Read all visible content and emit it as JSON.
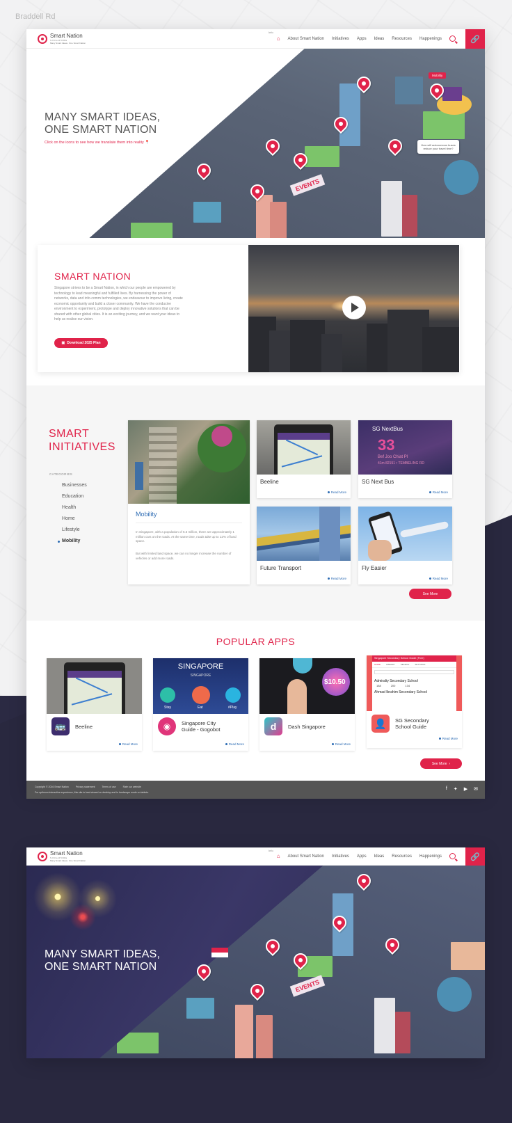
{
  "street_label": "Braddell Rd",
  "nav": {
    "logo_title": "Smart Nation",
    "logo_country": "S I N G A P O R E",
    "logo_tagline": "Many Smart Ideas • One Smart Nation",
    "lang": "Info",
    "items": [
      "About Smart Nation",
      "Initiatives",
      "Apps",
      "Ideas",
      "Resources",
      "Happenings"
    ],
    "link_icon": "link-icon"
  },
  "hero": {
    "title_line1": "MANY SMART IDEAS,",
    "title_line2": "ONE SMART NATION",
    "subtitle": "Click on the icons to see how we translate them into reality",
    "mobility_tag": "Mobility",
    "bubble_text": "How will autonomous buses reduce your travel time?",
    "events_sign": "EVENTS"
  },
  "smart_nation": {
    "title": "SMART NATION",
    "body": "Singapore strives to be a Smart Nation, in which our people are empowered by technology to lead meaningful and fulfilled lives. By harnessing the power of networks, data and info-comm technologies, we endeavour to improve living, create economic opportunity and build a closer community. We have the conducive environment to experiment, prototype and deploy innovative solutions that can be shared with other global cities. It is an exciting journey, and we want your ideas to help us realise our vision.",
    "button": "Download 2025 Plan"
  },
  "initiatives": {
    "title_line1": "SMART",
    "title_line2": "INITIATIVES",
    "categories_label": "CATEGORIES",
    "categories": [
      "Businesses",
      "Education",
      "Health",
      "Home",
      "Lifestyle",
      "Mobility"
    ],
    "active_category": "Mobility",
    "feature": {
      "title": "Mobility",
      "p1": "In Singapore, with a population of 5.6 million, there are approximately 1 million cars on the roads. At the same time, roads take up to 12% of land space.",
      "p2": "But with limited land space, we can no longer increase the number of vehicles or add more roads."
    },
    "cards": [
      {
        "title": "Beeline",
        "read": "Read More"
      },
      {
        "title": "SG Next Bus",
        "read": "Read More"
      },
      {
        "title": "Future Transport",
        "read": "Read More"
      },
      {
        "title": "Fly Easier",
        "read": "Read More"
      }
    ],
    "nextbus": {
      "header": "SG NextBus",
      "number": "33",
      "stop": "Bef Joo Chiat Pl",
      "info": "41m 82151 • TEMBELING RD"
    },
    "see_more": "See More"
  },
  "popular_apps": {
    "title": "POPULAR APPS",
    "apps": [
      {
        "name_line1": "Beeline",
        "name_line2": "",
        "read": "Read More"
      },
      {
        "name_line1": "Singapore City",
        "name_line2": "Guide - Gogobot",
        "read": "Read More"
      },
      {
        "name_line1": "Dash Singapore",
        "name_line2": "",
        "read": "Read More"
      },
      {
        "name_line1": "SG Secondary",
        "name_line2": "School Guide",
        "read": "Read More"
      }
    ],
    "gogobot": {
      "header": "SINGAPORE",
      "sub": "SINGAPORE",
      "labels": [
        "Stay",
        "Eat",
        "#Play"
      ]
    },
    "school": {
      "header": "Singapore Secondary School Guide (Free)",
      "tabs": [
        "HOME",
        "LIBRARY",
        "SEARCH",
        "SETTINGS"
      ],
      "school1": "Admiralty Secondary School",
      "stats": [
        "188",
        "200",
        "134"
      ],
      "school2": "Ahmad Ibrahim Secondary School"
    },
    "dash_price": "$10.50",
    "see_more": "See More"
  },
  "footer": {
    "copyright": "Copyright © 2016 Smart Nation",
    "links": [
      "Privacy statement",
      "Terms of use",
      "Rate our website"
    ],
    "note": "For optimum interactive experience, this site is best viewed on desktop and in landscape mode on tablets.",
    "social": [
      "facebook-icon",
      "twitter-icon",
      "youtube-icon",
      "email-icon"
    ]
  },
  "second": {
    "title_line1": "MANY SMART IDEAS,",
    "title_line2": "ONE SMART NATION",
    "events_sign": "EVENTS"
  },
  "colors": {
    "accent": "#e0234a",
    "link": "#2c6bb3",
    "dark_bg": "#29283f"
  }
}
